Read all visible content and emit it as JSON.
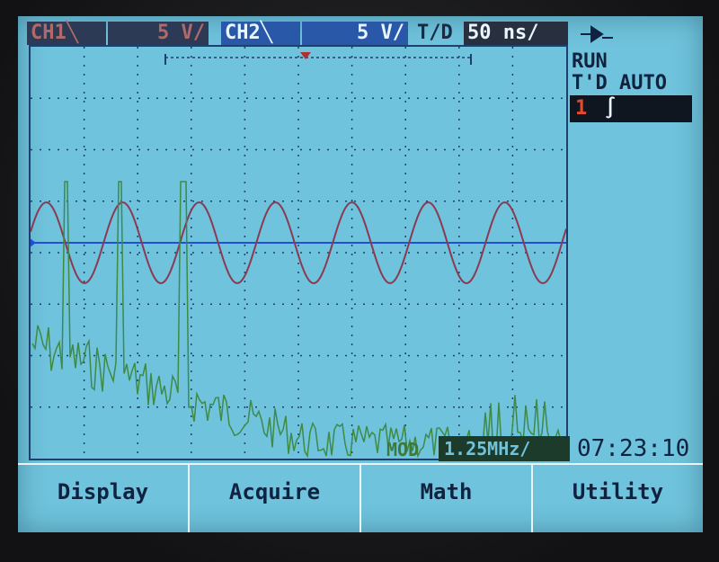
{
  "header": {
    "ch1_label": "CH1╲",
    "ch1_scale": "5  V/",
    "ch2_label": "CH2╲",
    "ch2_scale": "5  V/",
    "td_label": "T/D",
    "td_value": "50 ns/"
  },
  "status": {
    "run_state": "RUN",
    "trigger_mode": "T'D AUTO",
    "trigger_source": "1",
    "trigger_edge": "∫"
  },
  "mode": {
    "label": "MOD",
    "value": "1.25MHz/"
  },
  "clock": "07:23:10",
  "softkeys": [
    "Display",
    "Acquire",
    "Math",
    "Utility"
  ],
  "colors": {
    "screen_bg": "#6fc3dc",
    "grid": "#1e3f70",
    "ch1_trace": "#8a3a52",
    "ch2_trace": "#3f8a45",
    "ground_line": "#2050d8"
  },
  "icons": {
    "arrow_icon": "trigger-arrow-icon",
    "marker_icon": "trigger-position-marker-icon"
  }
}
